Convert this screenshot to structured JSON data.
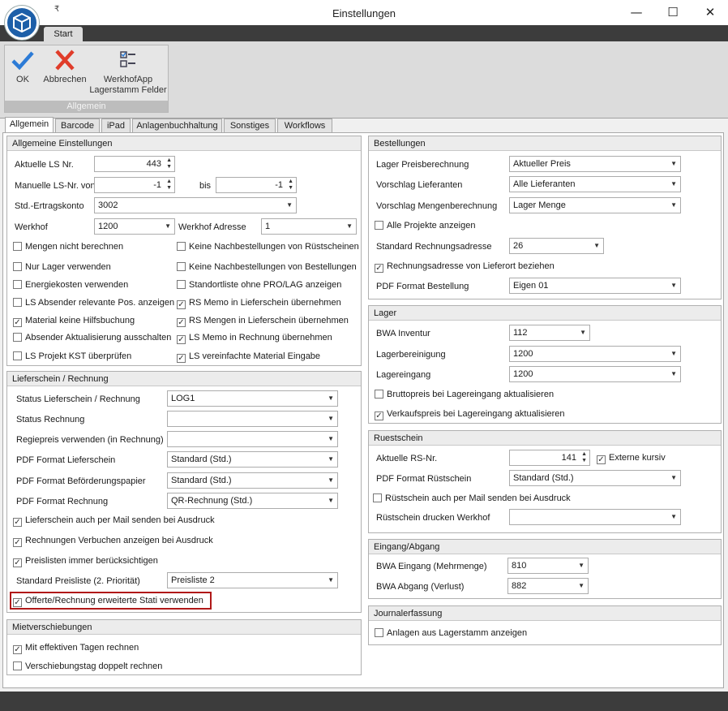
{
  "window": {
    "title": "Einstellungen",
    "minimize": "—",
    "maximize": "☐",
    "close": "✕",
    "qat": "₹"
  },
  "ribbon": {
    "tab": "Start",
    "group_label": "Allgemein",
    "ok": "OK",
    "cancel": "Abbrechen",
    "werkhof_1": "WerkhofApp",
    "werkhof_2": "Lagerstamm Felder"
  },
  "tabs": [
    "Allgemein",
    "Barcode",
    "iPad",
    "Anlagenbuchhaltung",
    "Sonstiges",
    "Workflows"
  ],
  "allgemein": {
    "title": "Allgemeine Einstellungen",
    "ls_nr_label": "Aktuelle LS Nr.",
    "ls_nr": "443",
    "manual_label": "Manuelle LS-Nr. von",
    "manual_from": "-1",
    "bis_label": "bis",
    "manual_to": "-1",
    "konto_label": "Std.-Ertragskonto",
    "konto": "3002",
    "werkhof_label": "Werkhof",
    "werkhof": "1200",
    "werkhof_adr_label": "Werkhof Adresse",
    "werkhof_adr": "1",
    "checks": [
      {
        "label": "Mengen nicht berechnen",
        "checked": false
      },
      {
        "label": "Keine Nachbestellungen von Rüstscheinen",
        "checked": false
      },
      {
        "label": "Nur Lager verwenden",
        "checked": false
      },
      {
        "label": "Keine Nachbestellungen von Bestellungen",
        "checked": false
      },
      {
        "label": "Energiekosten verwenden",
        "checked": false
      },
      {
        "label": "Standortliste ohne PRO/LAG anzeigen",
        "checked": false
      },
      {
        "label": "LS Absender relevante Pos. anzeigen",
        "checked": false
      },
      {
        "label": "RS Memo in Lieferschein übernehmen",
        "checked": true
      },
      {
        "label": "Material keine Hilfsbuchung",
        "checked": true
      },
      {
        "label": "RS Mengen in Lieferschein übernehmen",
        "checked": true
      },
      {
        "label": "Absender Aktualisierung ausschalten",
        "checked": false
      },
      {
        "label": "LS Memo in Rechnung übernehmen",
        "checked": true
      },
      {
        "label": "LS Projekt KST überprüfen",
        "checked": false
      },
      {
        "label": "LS vereinfachte Material Eingabe",
        "checked": true
      }
    ]
  },
  "lieferschein": {
    "title": "Lieferschein / Rechnung",
    "status_ls_label": "Status Lieferschein / Rechnung",
    "status_ls": "LOG1",
    "status_re_label": "Status Rechnung",
    "status_re": "",
    "regie_label": "Regiepreis verwenden (in Rechnung)",
    "regie": "",
    "pdf_ls_label": "PDF Format Lieferschein",
    "pdf_ls": "Standard (Std.)",
    "pdf_bef_label": "PDF Format Beförderungspapier",
    "pdf_bef": "Standard (Std.)",
    "pdf_re_label": "PDF Format Rechnung",
    "pdf_re": "QR-Rechnung (Std.)",
    "mail": "Lieferschein auch per Mail senden bei Ausdruck",
    "verbuchen": "Rechnungen Verbuchen anzeigen bei Ausdruck",
    "preislisten": "Preislisten immer berücksichtigen",
    "std_preisliste_label": "Standard Preisliste (2. Priorität)",
    "std_preisliste": "Preisliste 2",
    "offerte": "Offerte/Rechnung erweiterte Stati verwenden"
  },
  "miet": {
    "title": "Mietverschiebungen",
    "eff": "Mit effektiven Tagen rechnen",
    "doppelt": "Verschiebungstag doppelt rechnen"
  },
  "bestellungen": {
    "title": "Bestellungen",
    "preis_label": "Lager Preisberechnung",
    "preis": "Aktueller Preis",
    "lief_label": "Vorschlag Lieferanten",
    "lief": "Alle Lieferanten",
    "menge_label": "Vorschlag Mengenberechnung",
    "menge": "Lager Menge",
    "alle_proj": "Alle Projekte anzeigen",
    "adr_label": "Standard Rechnungsadresse",
    "adr": "26",
    "lieferort": "Rechnungsadresse von Lieferort beziehen",
    "pdf_label": "PDF Format Bestellung",
    "pdf": "Eigen 01"
  },
  "lager": {
    "title": "Lager",
    "bwa_label": "BWA Inventur",
    "bwa": "112",
    "bereinigung_label": "Lagerbereinigung",
    "bereinigung": "1200",
    "eingang_label": "Lagereingang",
    "eingang": "1200",
    "brutto": "Bruttopreis bei Lagereingang aktualisieren",
    "verkauf": "Verkaufspreis bei Lagereingang aktualisieren"
  },
  "ruest": {
    "title": "Ruestschein",
    "rs_label": "Aktuelle RS-Nr.",
    "rs": "141",
    "extern": "Externe kursiv",
    "pdf_label": "PDF Format Rüstschein",
    "pdf": "Standard (Std.)",
    "mail": "Rüstschein auch per Mail senden bei Ausdruck",
    "werkhof_label": "Rüstschein drucken Werkhof",
    "werkhof": ""
  },
  "eingang": {
    "title": "Eingang/Abgang",
    "ein_label": "BWA Eingang (Mehrmenge)",
    "ein": "810",
    "ab_label": "BWA Abgang (Verlust)",
    "ab": "882"
  },
  "journal": {
    "title": "Journalerfassung",
    "anlagen": "Anlagen aus Lagerstamm anzeigen"
  }
}
